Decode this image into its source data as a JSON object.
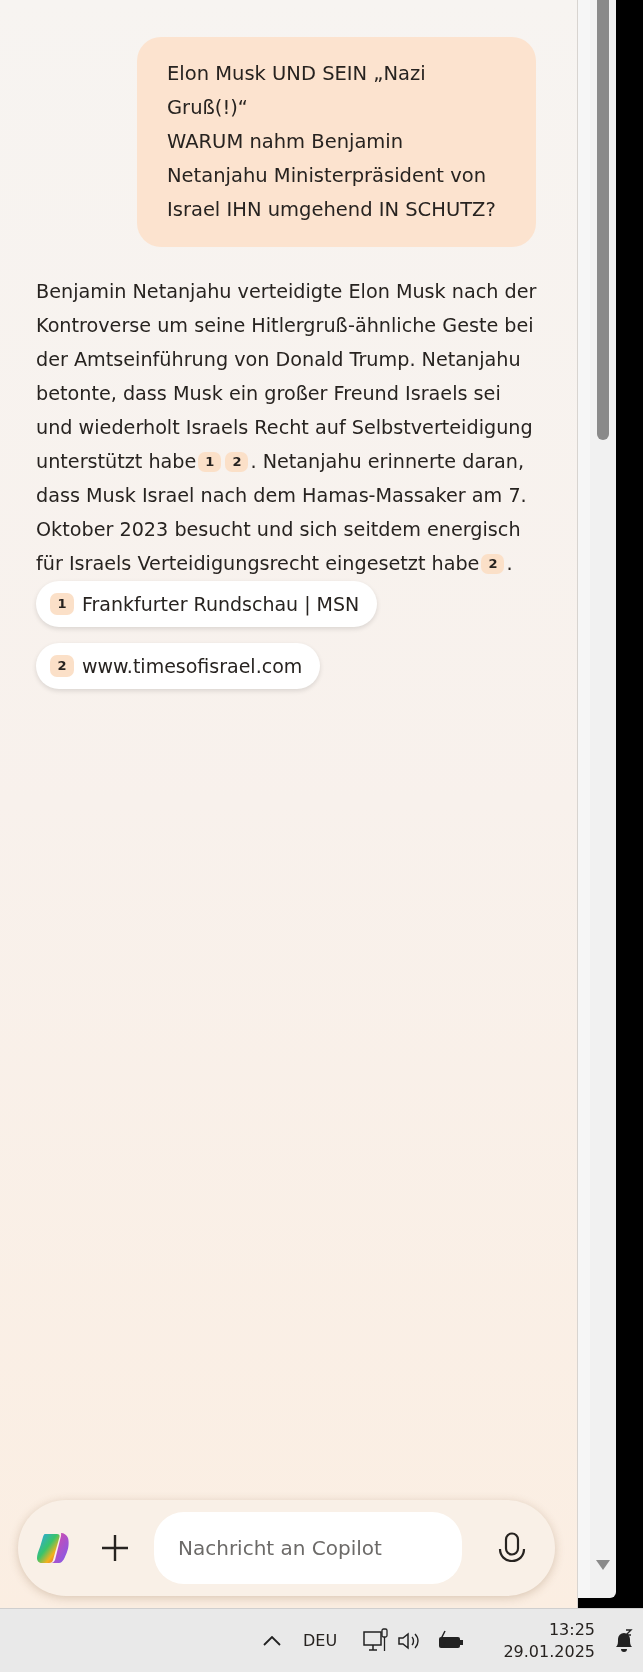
{
  "user_message": {
    "lines": [
      "Elon Musk UND SEIN „Nazi Gruß(!)“",
      "WARUM nahm Benjamin Netanjahu Ministerpräsident von Israel IHN umgehend IN SCHUTZ?"
    ]
  },
  "answer": {
    "segments": [
      {
        "kind": "text",
        "text": "Benjamin Netanjahu verteidigte Elon Musk nach der Kontroverse um seine Hitlergruß-ähnliche Geste bei der Amtseinführung von Donald Trump. Netanjahu betonte, dass Musk ein großer Freund Israels sei und wiederholt Israels Recht auf Selbstverteidigung unterstützt habe"
      },
      {
        "kind": "cite",
        "text": "1"
      },
      {
        "kind": "cite",
        "text": "2"
      },
      {
        "kind": "text",
        "text": ". Netanjahu erinnerte daran, dass Musk Israel nach dem Hamas-Massaker am 7. Oktober 2023 besucht und sich seitdem energisch für Israels Verteidigungsrecht eingesetzt habe"
      },
      {
        "kind": "cite",
        "text": "2"
      },
      {
        "kind": "text",
        "text": "."
      }
    ]
  },
  "sources": [
    {
      "number": "1",
      "title": "Frankfurter Rundschau | MSN"
    },
    {
      "number": "2",
      "title": "www.timesofisrael.com"
    }
  ],
  "composer": {
    "placeholder": "Nachricht an Copilot"
  },
  "taskbar": {
    "language": "DEU",
    "time": "13:25",
    "date": "29.01.2025"
  }
}
